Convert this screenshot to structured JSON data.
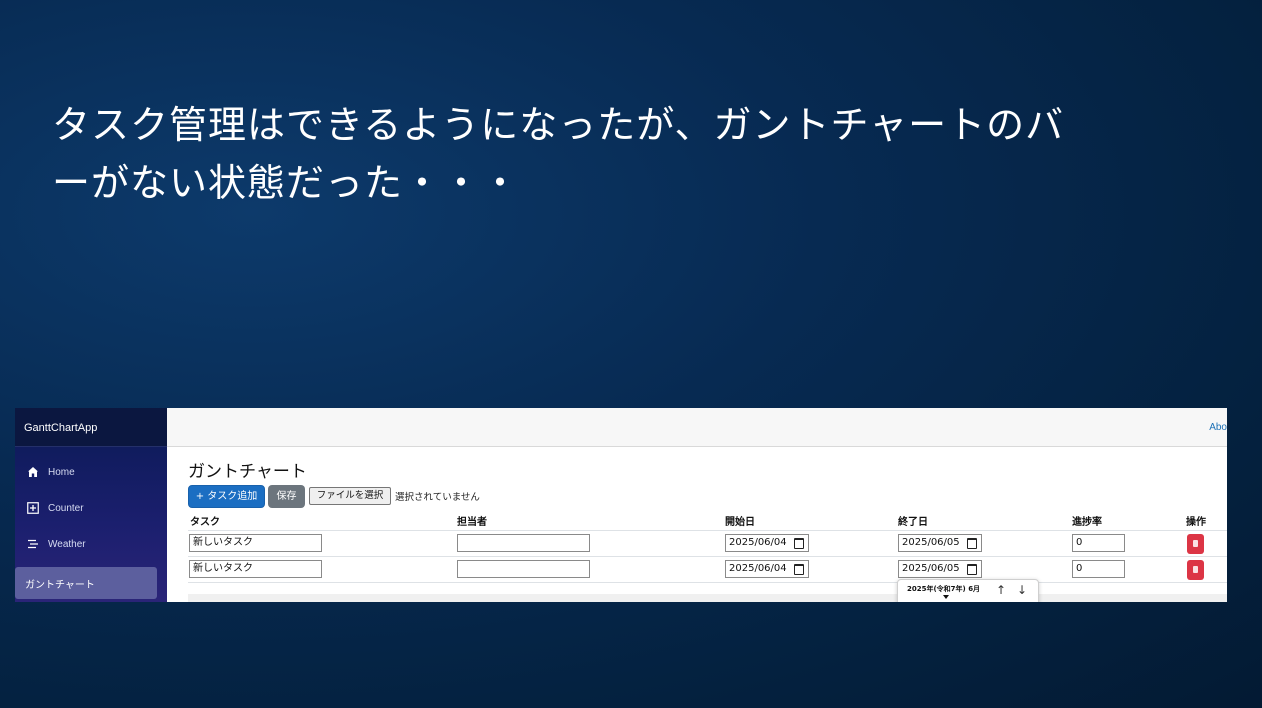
{
  "slide": {
    "title_line1": "タスク管理はできるようになったが、ガントチャートのバ",
    "title_line2": "ーがない状態だった・・・"
  },
  "app": {
    "brand": "GanttChartApp",
    "about_link": "Abo",
    "nav": [
      {
        "label": "Home",
        "icon": "home-icon"
      },
      {
        "label": "Counter",
        "icon": "plus-icon"
      },
      {
        "label": "Weather",
        "icon": "list-icon"
      },
      {
        "label": "ガントチャート",
        "active": true
      }
    ]
  },
  "page": {
    "title": "ガントチャート",
    "add_task_button": "+ タスク追加",
    "save_button": "保存",
    "file_button": "ファイルを選択",
    "file_status": "選択されていません"
  },
  "table": {
    "headers": [
      "タスク",
      "担当者",
      "開始日",
      "終了日",
      "進捗率",
      "操作"
    ],
    "rows": [
      {
        "task": "新しいタスク",
        "assignee": "",
        "start": "2025/06/04",
        "end": "2025/06/05",
        "progress": "0"
      },
      {
        "task": "新しいタスク",
        "assignee": "",
        "start": "2025/06/04",
        "end": "2025/06/05",
        "progress": "0"
      }
    ]
  },
  "calendar_popup": {
    "month_label": "2025年(令和7年) 6月",
    "up_arrow": "↑",
    "down_arrow": "↓"
  },
  "colors": {
    "primary_button": "#1b6ec2",
    "secondary_button": "#6c757d",
    "delete_button": "#dc3545",
    "sidebar_top": "#0a1a55",
    "sidebar_bottom": "#2a2478"
  }
}
